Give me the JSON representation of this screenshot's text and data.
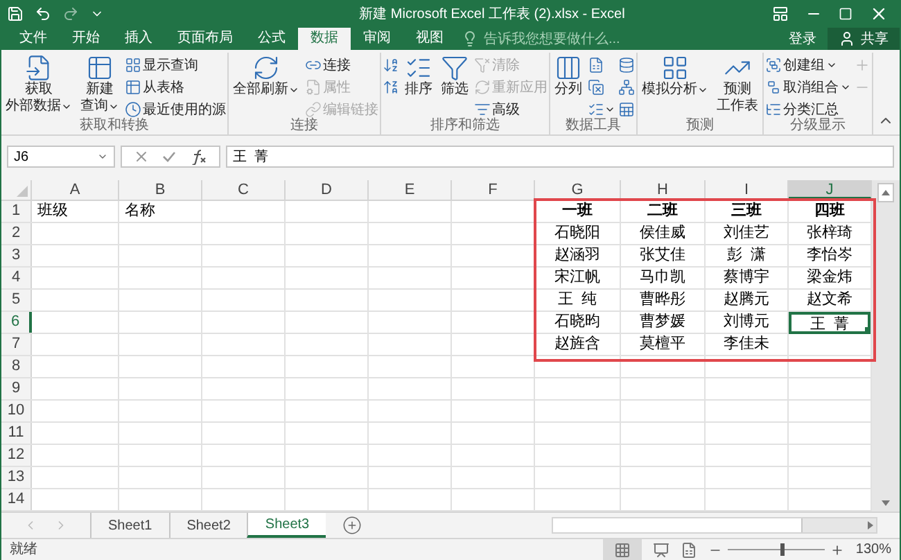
{
  "title_bar": {
    "title": "新建 Microsoft Excel 工作表 (2).xlsx - Excel"
  },
  "ribbon_tabs": [
    {
      "label": "文件",
      "selected": false
    },
    {
      "label": "开始",
      "selected": false
    },
    {
      "label": "插入",
      "selected": false
    },
    {
      "label": "页面布局",
      "selected": false
    },
    {
      "label": "公式",
      "selected": false
    },
    {
      "label": "数据",
      "selected": true
    },
    {
      "label": "审阅",
      "selected": false
    },
    {
      "label": "视图",
      "selected": false
    }
  ],
  "tell_me": {
    "placeholder": "告诉我您想要做什么..."
  },
  "sign_in": "登录",
  "share": "共享",
  "ribbon_groups": [
    {
      "label": "获取和转换",
      "commands": [
        {
          "kind": "large",
          "lines": [
            "获取",
            "外部数据"
          ],
          "dropdown": true,
          "disabled": false
        },
        {
          "kind": "large",
          "lines": [
            "新建",
            "查询"
          ],
          "dropdown": true,
          "disabled": false
        },
        {
          "kind": "small",
          "label": "显示查询",
          "dropdown": false,
          "disabled": false
        },
        {
          "kind": "small",
          "label": "从表格",
          "dropdown": false,
          "disabled": false
        },
        {
          "kind": "small",
          "label": "最近使用的源",
          "dropdown": false,
          "disabled": false
        }
      ]
    },
    {
      "label": "连接",
      "commands": [
        {
          "kind": "large",
          "lines": [
            "全部刷新"
          ],
          "dropdown": true,
          "disabled": false
        },
        {
          "kind": "small",
          "label": "连接",
          "dropdown": false,
          "disabled": false
        },
        {
          "kind": "small",
          "label": "属性",
          "dropdown": false,
          "disabled": true
        },
        {
          "kind": "small",
          "label": "编辑链接",
          "dropdown": false,
          "disabled": true
        }
      ]
    },
    {
      "label": "排序和筛选",
      "commands": [
        {
          "kind": "icon",
          "dropdown": false,
          "disabled": false
        },
        {
          "kind": "icon",
          "dropdown": false,
          "disabled": false
        },
        {
          "kind": "large",
          "lines": [
            "排序"
          ],
          "dropdown": false,
          "disabled": false
        },
        {
          "kind": "large",
          "lines": [
            "筛选"
          ],
          "dropdown": false,
          "disabled": false
        },
        {
          "kind": "small",
          "label": "清除",
          "dropdown": false,
          "disabled": true
        },
        {
          "kind": "small",
          "label": "重新应用",
          "dropdown": false,
          "disabled": true
        },
        {
          "kind": "small",
          "label": "高级",
          "dropdown": false,
          "disabled": false
        }
      ]
    },
    {
      "label": "数据工具",
      "commands": [
        {
          "kind": "large",
          "lines": [
            "分列"
          ],
          "dropdown": false,
          "disabled": false
        },
        {
          "kind": "icon",
          "dropdown": false,
          "disabled": false
        },
        {
          "kind": "icon",
          "dropdown": false,
          "disabled": false
        },
        {
          "kind": "icon",
          "dropdown": true,
          "disabled": false
        },
        {
          "kind": "icon",
          "dropdown": false,
          "disabled": false
        },
        {
          "kind": "icon",
          "dropdown": false,
          "disabled": false
        },
        {
          "kind": "icon",
          "dropdown": false,
          "disabled": false
        }
      ]
    },
    {
      "label": "预测",
      "commands": [
        {
          "kind": "large",
          "lines": [
            "模拟分析"
          ],
          "dropdown": true,
          "disabled": false
        },
        {
          "kind": "large",
          "lines": [
            "预测",
            "工作表"
          ],
          "dropdown": false,
          "disabled": false
        }
      ]
    },
    {
      "label": "分级显示",
      "commands": [
        {
          "kind": "small",
          "label": "创建组",
          "dropdown": true,
          "disabled": false
        },
        {
          "kind": "small",
          "label": "取消组合",
          "dropdown": true,
          "disabled": false
        },
        {
          "kind": "small",
          "label": "分类汇总",
          "dropdown": false,
          "disabled": false
        },
        {
          "kind": "icon",
          "dropdown": false,
          "disabled": true
        },
        {
          "kind": "icon",
          "dropdown": false,
          "disabled": true
        }
      ]
    }
  ],
  "formula_bar": {
    "name_box": "J6",
    "value": "王  菁"
  },
  "sheet": {
    "columns": [
      {
        "label": "A",
        "selected": false
      },
      {
        "label": "B",
        "selected": false
      },
      {
        "label": "C",
        "selected": false
      },
      {
        "label": "D",
        "selected": false
      },
      {
        "label": "E",
        "selected": false
      },
      {
        "label": "F",
        "selected": false
      },
      {
        "label": "G",
        "selected": false
      },
      {
        "label": "H",
        "selected": false
      },
      {
        "label": "I",
        "selected": false
      },
      {
        "label": "J",
        "selected": true
      }
    ],
    "rows": [
      {
        "label": "1",
        "selected": false,
        "cells": [
          {
            "text": "班级",
            "bold": false,
            "selected": false
          },
          {
            "text": "名称",
            "bold": false,
            "selected": false
          },
          null,
          null,
          null,
          null,
          {
            "text": "一班",
            "bold": true,
            "selected": false
          },
          {
            "text": "二班",
            "bold": true,
            "selected": false
          },
          {
            "text": "三班",
            "bold": true,
            "selected": false
          },
          {
            "text": "四班",
            "bold": true,
            "selected": false
          }
        ]
      },
      {
        "label": "2",
        "selected": false,
        "cells": [
          null,
          null,
          null,
          null,
          null,
          null,
          {
            "text": "石晓阳",
            "bold": false,
            "selected": false
          },
          {
            "text": "侯佳威",
            "bold": false,
            "selected": false
          },
          {
            "text": "刘佳艺",
            "bold": false,
            "selected": false
          },
          {
            "text": "张梓琦",
            "bold": false,
            "selected": false
          }
        ]
      },
      {
        "label": "3",
        "selected": false,
        "cells": [
          null,
          null,
          null,
          null,
          null,
          null,
          {
            "text": "赵涵羽",
            "bold": false,
            "selected": false
          },
          {
            "text": "张艾佳",
            "bold": false,
            "selected": false
          },
          {
            "text": "彭  潇",
            "bold": false,
            "selected": false
          },
          {
            "text": "李怡岑",
            "bold": false,
            "selected": false
          }
        ]
      },
      {
        "label": "4",
        "selected": false,
        "cells": [
          null,
          null,
          null,
          null,
          null,
          null,
          {
            "text": "宋江帆",
            "bold": false,
            "selected": false
          },
          {
            "text": "马巾凯",
            "bold": false,
            "selected": false
          },
          {
            "text": "蔡博宇",
            "bold": false,
            "selected": false
          },
          {
            "text": "梁金炜",
            "bold": false,
            "selected": false
          }
        ]
      },
      {
        "label": "5",
        "selected": false,
        "cells": [
          null,
          null,
          null,
          null,
          null,
          null,
          {
            "text": "王  纯",
            "bold": false,
            "selected": false
          },
          {
            "text": "曹晔彤",
            "bold": false,
            "selected": false
          },
          {
            "text": "赵腾元",
            "bold": false,
            "selected": false
          },
          {
            "text": "赵文希",
            "bold": false,
            "selected": false
          }
        ]
      },
      {
        "label": "6",
        "selected": true,
        "cells": [
          null,
          null,
          null,
          null,
          null,
          null,
          {
            "text": "石晓昀",
            "bold": false,
            "selected": false
          },
          {
            "text": "曹梦媛",
            "bold": false,
            "selected": false
          },
          {
            "text": "刘博元",
            "bold": false,
            "selected": false
          },
          {
            "text": "王  菁",
            "bold": false,
            "selected": true
          }
        ]
      },
      {
        "label": "7",
        "selected": false,
        "cells": [
          null,
          null,
          null,
          null,
          null,
          null,
          {
            "text": "赵旌含",
            "bold": false,
            "selected": false
          },
          {
            "text": "莫檀平",
            "bold": false,
            "selected": false
          },
          {
            "text": "李佳未",
            "bold": false,
            "selected": false
          },
          null
        ]
      },
      {
        "label": "8",
        "selected": false
      },
      {
        "label": "9",
        "selected": false
      },
      {
        "label": "10",
        "selected": false
      },
      {
        "label": "11",
        "selected": false
      },
      {
        "label": "12",
        "selected": false
      },
      {
        "label": "13",
        "selected": false
      },
      {
        "label": "14",
        "selected": false
      }
    ]
  },
  "sheet_tabs": [
    {
      "label": "Sheet1",
      "selected": false
    },
    {
      "label": "Sheet2",
      "selected": false
    },
    {
      "label": "Sheet3",
      "selected": true
    }
  ],
  "status_bar": {
    "status": "就绪",
    "zoom": {
      "level": 0.55,
      "reading": "130%"
    }
  }
}
